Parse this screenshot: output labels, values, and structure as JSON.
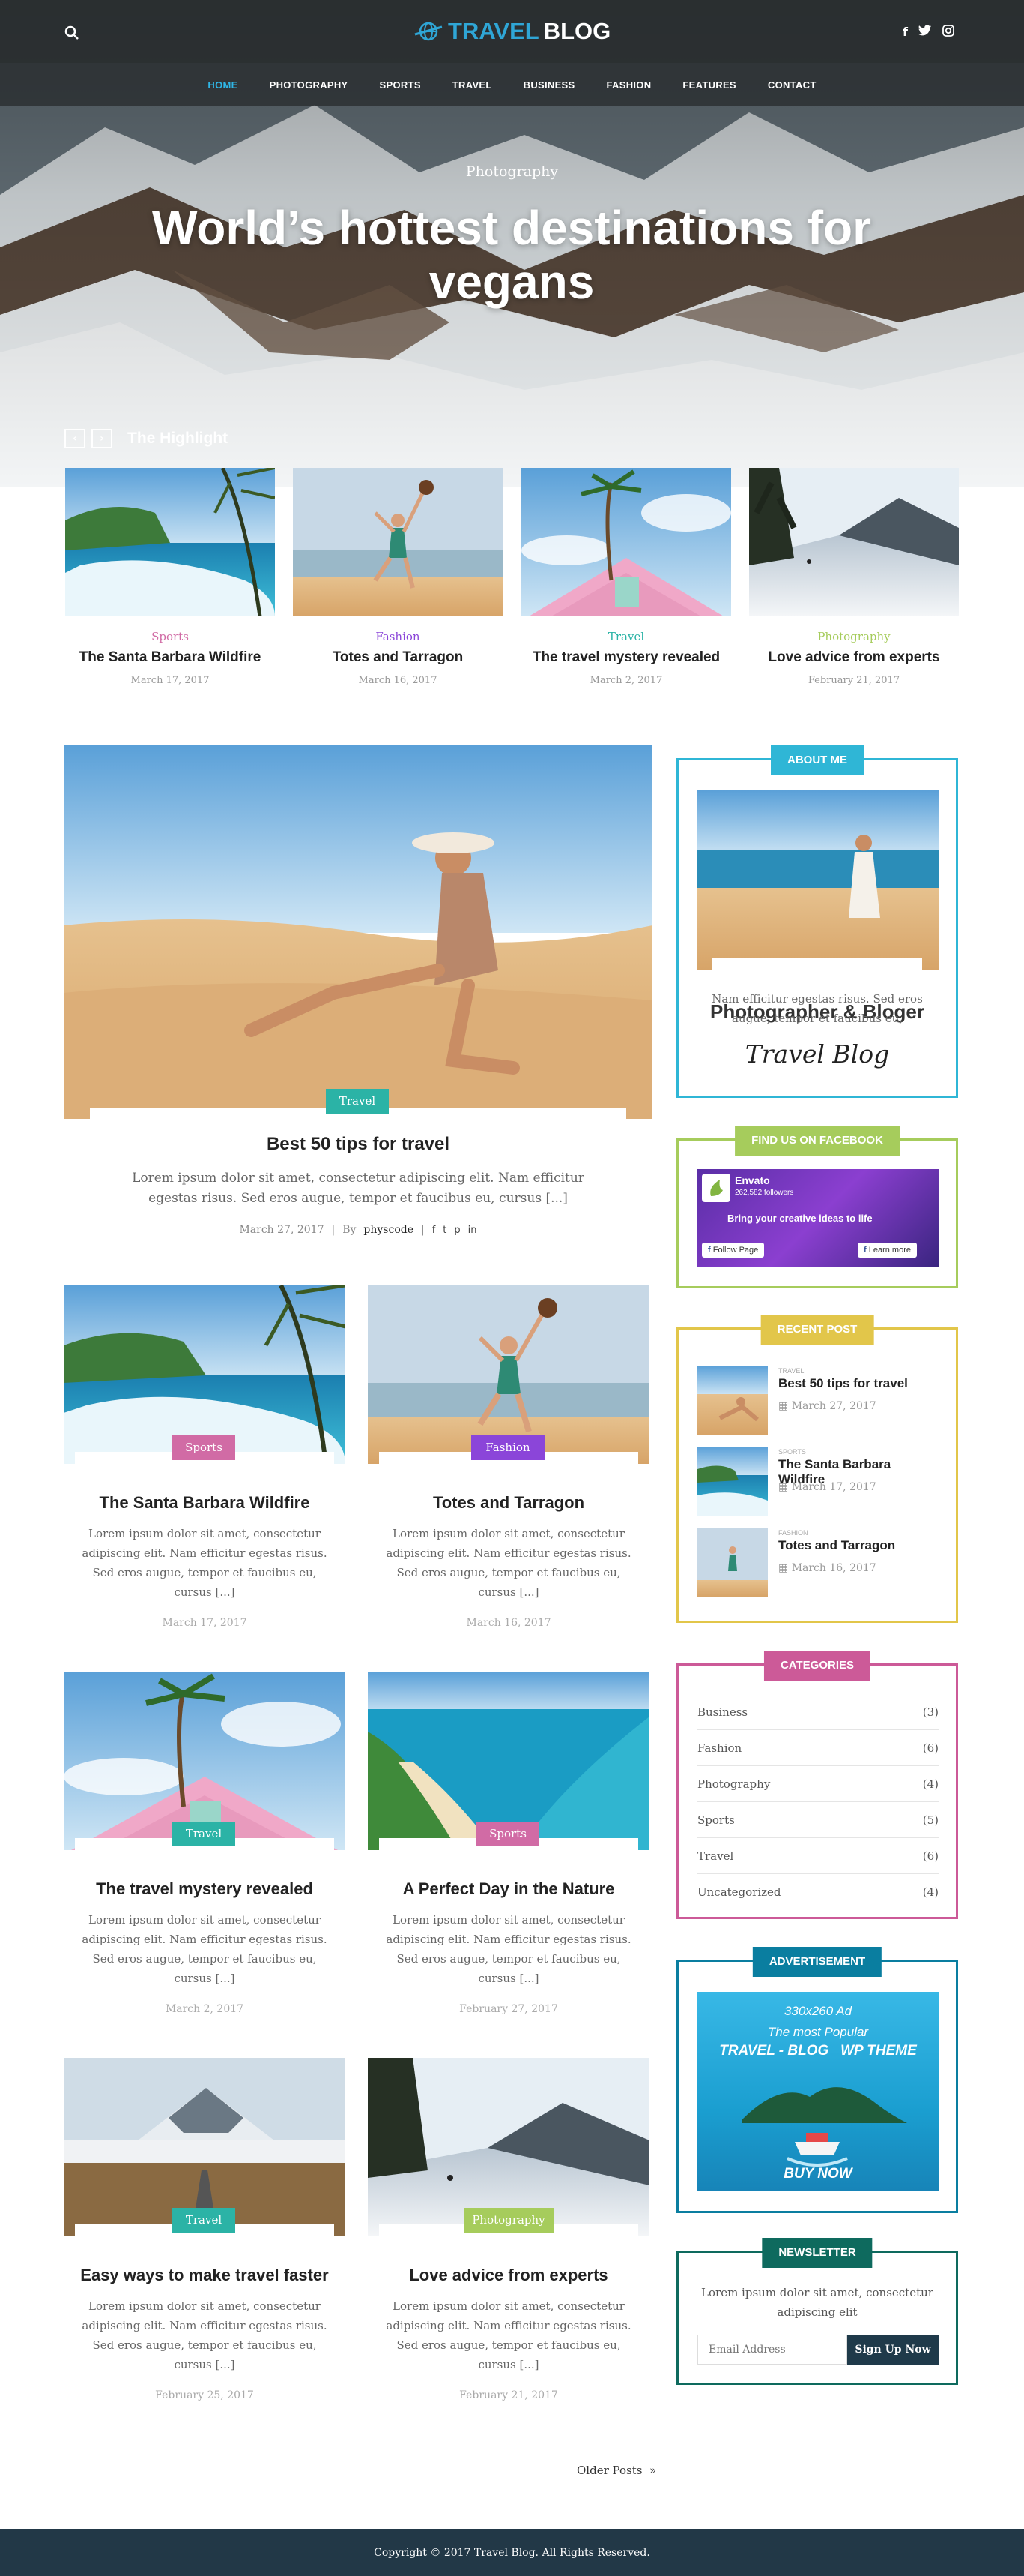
{
  "colors": {
    "accent": "#2fb6e6",
    "sports": "#d16ba5",
    "fashion": "#8b45d9",
    "travel": "#2bb3a6",
    "photography": "#a6cc5c",
    "dark": "#223847"
  },
  "header": {
    "logo_part1": "TRAVEL",
    "logo_part2": "BLOG",
    "search_icon": "search-icon",
    "social": [
      "facebook-icon",
      "twitter-icon",
      "instagram-icon"
    ],
    "nav": [
      "HOME",
      "PHOTOGRAPHY",
      "SPORTS",
      "TRAVEL",
      "BUSINESS",
      "FASHION",
      "FEATURES",
      "CONTACT"
    ],
    "nav_active": "HOME"
  },
  "hero": {
    "category": "Photography",
    "title": "World’s hottest destinations for vegans"
  },
  "highlight": {
    "label": "The Highlight",
    "items": [
      {
        "category": "Sports",
        "title": "The Santa Barbara Wildfire",
        "date": "March 17, 2017",
        "color": "#d16ba5"
      },
      {
        "category": "Fashion",
        "title": "Totes and Tarragon",
        "date": "March 16, 2017",
        "color": "#8b45d9"
      },
      {
        "category": "Travel",
        "title": "The travel mystery revealed",
        "date": "March 2, 2017",
        "color": "#2bb3a6"
      },
      {
        "category": "Photography",
        "title": "Love advice from experts",
        "date": "February 21, 2017",
        "color": "#a6cc5c"
      }
    ]
  },
  "featured": {
    "badge": "Travel",
    "title": "Best 50 tips for travel",
    "excerpt": "Lorem ipsum dolor sit amet, consectetur adipiscing elit. Nam efficitur egestas risus. Sed eros augue, tempor et faucibus eu, cursus [...]",
    "date": "March 27, 2017",
    "by": "By",
    "author": "physcode",
    "share": [
      "facebook-icon",
      "twitter-icon",
      "pinterest-icon",
      "linkedin-icon"
    ]
  },
  "posts": [
    {
      "badge": "Sports",
      "title": "The Santa Barbara Wildfire",
      "excerpt": "Lorem ipsum dolor sit amet, consectetur adipiscing elit. Nam efficitur egestas risus. Sed eros augue, tempor et faucibus eu, cursus [...]",
      "date": "March 17, 2017"
    },
    {
      "badge": "Fashion",
      "title": "Totes and Tarragon",
      "excerpt": "Lorem ipsum dolor sit amet, consectetur adipiscing elit. Nam efficitur egestas risus. Sed eros augue, tempor et faucibus eu, cursus [...]",
      "date": "March 16, 2017"
    },
    {
      "badge": "Travel",
      "title": "The travel mystery revealed",
      "excerpt": "Lorem ipsum dolor sit amet, consectetur adipiscing elit. Nam efficitur egestas risus. Sed eros augue, tempor et faucibus eu, cursus [...]",
      "date": "March 2, 2017"
    },
    {
      "badge": "Sports",
      "title": "A Perfect Day in the Nature",
      "excerpt": "Lorem ipsum dolor sit amet, consectetur adipiscing elit. Nam efficitur egestas risus. Sed eros augue, tempor et faucibus eu, cursus [...]",
      "date": "February 27, 2017"
    },
    {
      "badge": "Travel",
      "title": "Easy ways to make travel faster",
      "excerpt": "Lorem ipsum dolor sit amet, consectetur adipiscing elit. Nam efficitur egestas risus. Sed eros augue, tempor et faucibus eu, cursus [...]",
      "date": "February 25, 2017"
    },
    {
      "badge": "Photography",
      "title": "Love advice from experts",
      "excerpt": "Lorem ipsum dolor sit amet, consectetur adipiscing elit. Nam efficitur egestas risus. Sed eros augue, tempor et faucibus eu, cursus [...]",
      "date": "February 21, 2017"
    }
  ],
  "sidebar": {
    "about": {
      "heading": "ABOUT ME",
      "name": "Photographer & Bloger",
      "excerpt": "Nam efficitur egestas risus. Sed eros augue, tempor et faucibus eu,",
      "signature": "Travel Blog"
    },
    "facebook": {
      "heading": "FIND US ON FACEBOOK",
      "page": "Envato",
      "followers": "262,582 followers",
      "tagline": "Bring your creative ideas to life",
      "follow": "Follow Page",
      "learn": "Learn more"
    },
    "recent": {
      "heading": "RECENT POST",
      "items": [
        {
          "category": "Travel",
          "title": "Best 50 tips for travel",
          "date": "March 27, 2017"
        },
        {
          "category": "Sports",
          "title": "The Santa Barbara Wildfire",
          "date": "March 17, 2017"
        },
        {
          "category": "Fashion",
          "title": "Totes and Tarragon",
          "date": "March 16, 2017"
        }
      ]
    },
    "categories": {
      "heading": "CATEGORIES",
      "items": [
        {
          "name": "Business",
          "count": "(3)"
        },
        {
          "name": "Fashion",
          "count": "(6)"
        },
        {
          "name": "Photography",
          "count": "(4)"
        },
        {
          "name": "Sports",
          "count": "(5)"
        },
        {
          "name": "Travel",
          "count": "(6)"
        },
        {
          "name": "Uncategorized",
          "count": "(4)"
        }
      ]
    },
    "ad": {
      "heading": "ADVERTISEMENT",
      "size": "330x260 Ad",
      "line1": "The most Popular",
      "line2": "TRAVEL - BLOG   WP THEME",
      "cta": "BUY NOW"
    },
    "newsletter": {
      "heading": "NEWSLETTER",
      "text": "Lorem ipsum dolor sit amet, consectetur adipiscing elit",
      "placeholder": "Email Address",
      "button": "Sign Up Now"
    }
  },
  "pagination": {
    "older": "Older Posts  »"
  },
  "footer": {
    "copyright": "Copyright © 2017 Travel Blog. All Rights Reserved."
  }
}
